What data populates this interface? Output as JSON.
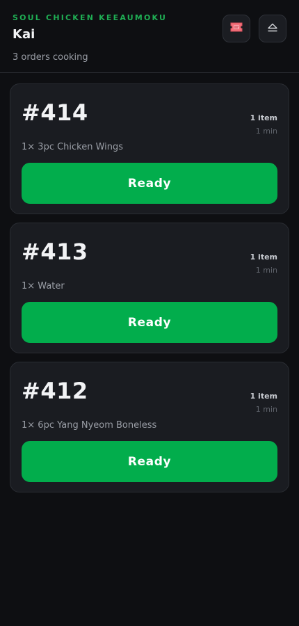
{
  "header": {
    "store_name": "SOUL CHICKEN KEEAUMOKU",
    "staff_name": "Kai",
    "status": "3 orders cooking",
    "ticket_icon": "ticket-icon",
    "eject_icon": "eject-icon"
  },
  "colors": {
    "accent_green": "#1fae54",
    "ready_button": "#02ad4c",
    "ticket_icon": "#f2707a",
    "background": "#0e0f12",
    "card": "#1a1c21"
  },
  "orders": [
    {
      "number": "#414",
      "item_count": "1 item",
      "elapsed": "1 min",
      "items": "1× 3pc Chicken Wings",
      "action_label": "Ready"
    },
    {
      "number": "#413",
      "item_count": "1 item",
      "elapsed": "1 min",
      "items": "1× Water",
      "action_label": "Ready"
    },
    {
      "number": "#412",
      "item_count": "1 item",
      "elapsed": "1 min",
      "items": "1× 6pc Yang Nyeom Boneless",
      "action_label": "Ready"
    }
  ]
}
